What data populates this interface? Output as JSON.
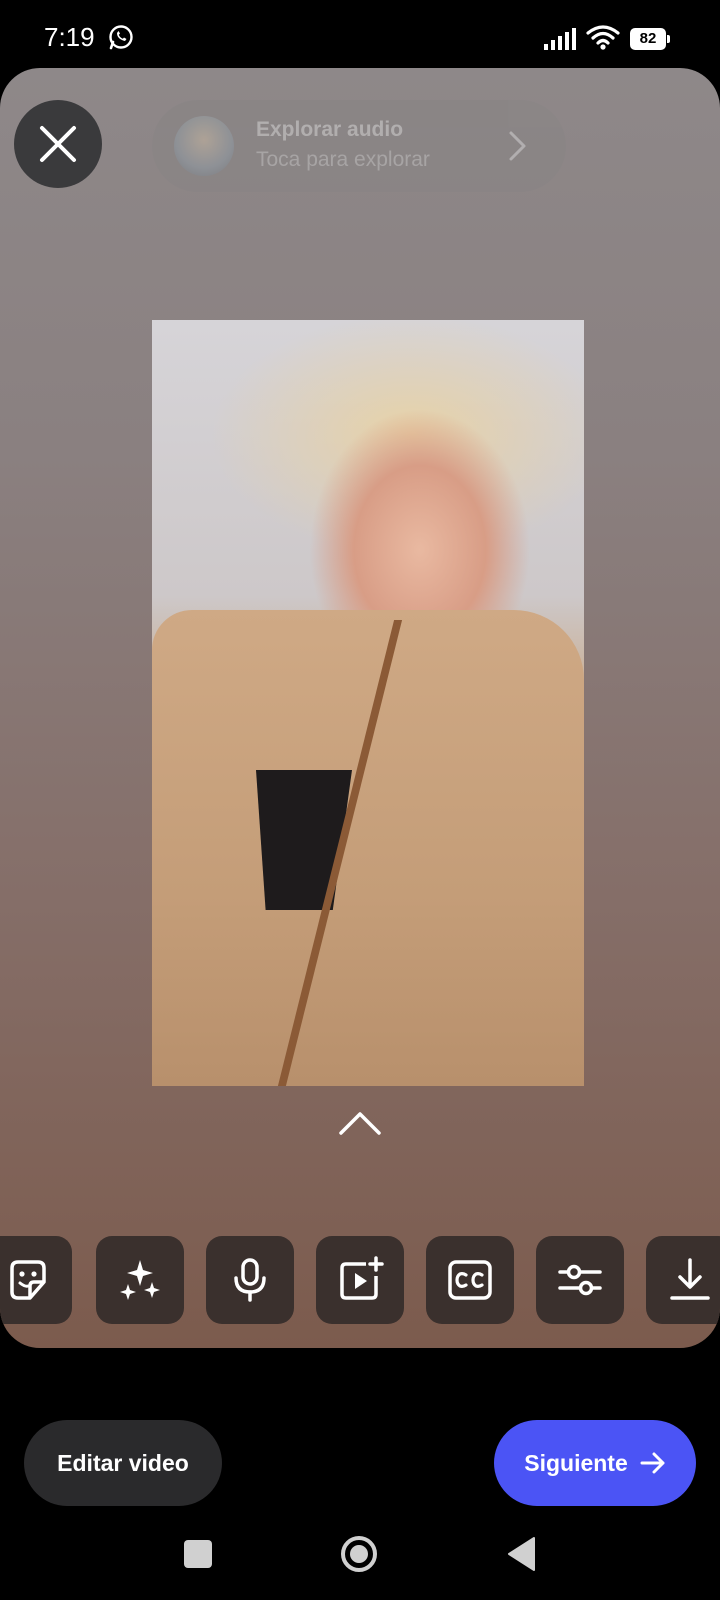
{
  "status_bar": {
    "time": "7:19",
    "battery": "82"
  },
  "audio": {
    "title": "Explorar audio",
    "subtitle": "Toca para explorar"
  },
  "toolbar": {
    "items": [
      "sticker",
      "effects",
      "voiceover",
      "add-clip",
      "captions",
      "adjust",
      "download"
    ]
  },
  "actions": {
    "edit_video": "Editar video",
    "next": "Siguiente"
  },
  "colors": {
    "accent": "#4b54f5",
    "panel_top": "#8e8889",
    "panel_bottom": "#7c5b4d"
  }
}
